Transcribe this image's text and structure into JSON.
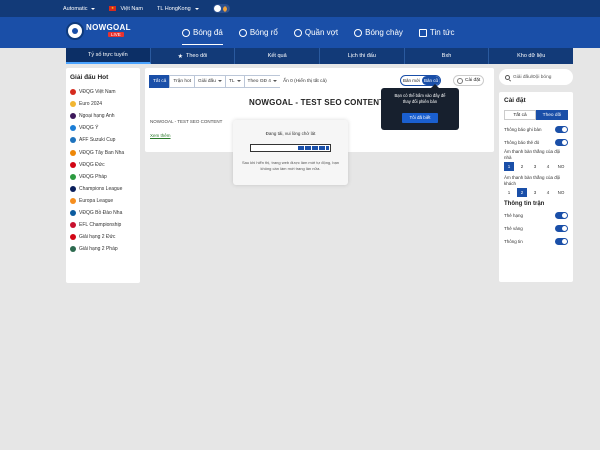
{
  "topbar": {
    "theme_select": "Automatic",
    "language": "Việt Nam",
    "timezone": "TL HongKong"
  },
  "logo": {
    "text": "NOWGOAL",
    "sub": "LIVE"
  },
  "nav": [
    {
      "label": "Bóng đá"
    },
    {
      "label": "Bóng rổ"
    },
    {
      "label": "Quần vợt"
    },
    {
      "label": "Bóng chày"
    },
    {
      "label": "Tin tức"
    }
  ],
  "subtabs": [
    {
      "label": "Tỷ số trực tuyến"
    },
    {
      "label": "Theo dõi"
    },
    {
      "label": "Kết quả"
    },
    {
      "label": "Lịch thi đấu"
    },
    {
      "label": "Bxh"
    },
    {
      "label": "Kho dữ liệu"
    }
  ],
  "left": {
    "title": "Giải đấu Hot",
    "leagues": [
      {
        "name": "VĐQG Việt Nam",
        "color": "#d52b1e"
      },
      {
        "name": "Euro 2024",
        "color": "#f2b632"
      },
      {
        "name": "Ngoại hạng Anh",
        "color": "#3d195b"
      },
      {
        "name": "VĐQG Ý",
        "color": "#1c7ed6"
      },
      {
        "name": "AFF Suzuki Cup",
        "color": "#1e73be"
      },
      {
        "name": "VĐQG Tây Ban Nha",
        "color": "#ee8707"
      },
      {
        "name": "VĐQG Đức",
        "color": "#d20515"
      },
      {
        "name": "VĐQG Pháp",
        "color": "#2b9a3f"
      },
      {
        "name": "Champions League",
        "color": "#0a1f5c"
      },
      {
        "name": "Europa League",
        "color": "#f68e1e"
      },
      {
        "name": "VĐQG Bồ Đào Nha",
        "color": "#0b5b9f"
      },
      {
        "name": "EFL Championship",
        "color": "#c8102e"
      },
      {
        "name": "Giải hạng 2 Đức",
        "color": "#d20515"
      },
      {
        "name": "Giải hạng 2 Pháp",
        "color": "#2d6a4f"
      }
    ]
  },
  "filters": {
    "items": [
      "Tất cả",
      "Trận hot",
      "Giải đấu",
      "TL",
      "Theo GĐ 4",
      "Ẩn 0 (Hiển thị tất cả)"
    ],
    "seg_left": "Bản mới",
    "seg_right": "Bản cũ",
    "settings": "Cài đặt"
  },
  "content": {
    "title": "NOWGOAL - TEST SEO CONTENT",
    "subtitle": "NOWGOAL - TEST SEO CONTENT",
    "link": "Xem thêm"
  },
  "loading": {
    "title": "Đang tải, vui lòng chờ lát",
    "progress": 0.4,
    "desc": "Sau khi hiển thị, trang web được làm mới tự động, bạn không cần làm mới trang lần nữa."
  },
  "tooltip": {
    "text": "Bạn có thể bấm vào đây để thay đổi phiên bản",
    "button": "Tôi đã biết"
  },
  "right": {
    "search_placeholder": "Giải đấu/Đội bóng",
    "settings_title": "Cài đặt",
    "tab_all": "Tất cả",
    "tab_follow": "Theo dõi",
    "toggle1": "Thông báo ghi bàn",
    "toggle2": "Thông báo thẻ đỏ",
    "sound_home": "Âm thanh bàn thắng của đội nhà",
    "sound_away": "Âm thanh bàn thắng của đội khách",
    "nums": [
      "1",
      "2",
      "3",
      "4",
      "NO"
    ],
    "match_info_title": "Thông tin trận",
    "toggle3": "Thẻ hạng",
    "toggle4": "Thẻ vàng",
    "toggle5": "Thông tin"
  }
}
